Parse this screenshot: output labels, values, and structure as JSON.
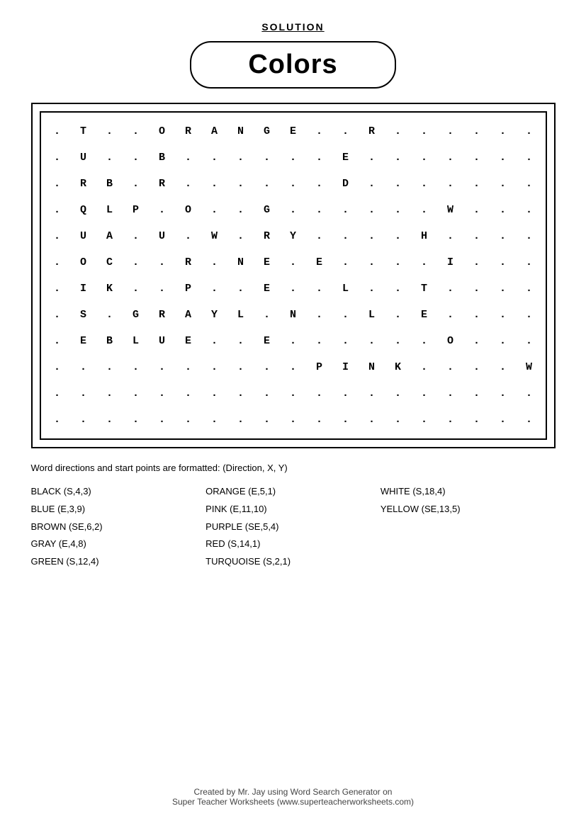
{
  "header": {
    "solution_label": "SOLUTION",
    "title": "Colors"
  },
  "grid": {
    "rows": [
      [
        ".",
        "T",
        ".",
        ".",
        "O",
        "R",
        "A",
        "N",
        "G",
        "E",
        ".",
        ".",
        "R",
        ".",
        ".",
        ".",
        ".",
        ".",
        "."
      ],
      [
        ".",
        "U",
        ".",
        ".",
        "B",
        ".",
        ".",
        ".",
        ".",
        ".",
        ".",
        "E",
        ".",
        ".",
        ".",
        ".",
        ".",
        ".",
        "."
      ],
      [
        ".",
        "R",
        "B",
        ".",
        "R",
        ".",
        ".",
        ".",
        ".",
        ".",
        ".",
        "D",
        ".",
        ".",
        ".",
        ".",
        ".",
        ".",
        "."
      ],
      [
        ".",
        "Q",
        "L",
        "P",
        ".",
        "O",
        ".",
        ".",
        "G",
        ".",
        ".",
        ".",
        ".",
        ".",
        ".",
        "W",
        ".",
        ".",
        "."
      ],
      [
        ".",
        "U",
        "A",
        ".",
        "U",
        ".",
        "W",
        ".",
        "R",
        "Y",
        ".",
        ".",
        ".",
        ".",
        "H",
        ".",
        ".",
        ".",
        "."
      ],
      [
        ".",
        "O",
        "C",
        ".",
        ".",
        "R",
        ".",
        "N",
        "E",
        ".",
        "E",
        ".",
        ".",
        ".",
        ".",
        "I",
        ".",
        ".",
        "."
      ],
      [
        ".",
        "I",
        "K",
        ".",
        ".",
        "P",
        ".",
        ".",
        "E",
        ".",
        ".",
        "L",
        ".",
        ".",
        "T",
        ".",
        ".",
        ".",
        "."
      ],
      [
        ".",
        "S",
        ".",
        "G",
        "R",
        "A",
        "Y",
        "L",
        ".",
        "N",
        ".",
        ".",
        "L",
        ".",
        "E",
        ".",
        ".",
        ".",
        "."
      ],
      [
        ".",
        "E",
        "B",
        "L",
        "U",
        "E",
        ".",
        ".",
        "E",
        ".",
        ".",
        ".",
        ".",
        ".",
        ".",
        "O",
        ".",
        ".",
        "."
      ],
      [
        ".",
        ".",
        ".",
        ".",
        ".",
        ".",
        ".",
        ".",
        ".",
        ".",
        "P",
        "I",
        "N",
        "K",
        ".",
        ".",
        ".",
        ".",
        "W"
      ],
      [
        ".",
        ".",
        ".",
        ".",
        ".",
        ".",
        ".",
        ".",
        ".",
        ".",
        ".",
        ".",
        ".",
        ".",
        ".",
        ".",
        ".",
        ".",
        "."
      ],
      [
        ".",
        ".",
        ".",
        ".",
        ".",
        ".",
        ".",
        ".",
        ".",
        ".",
        ".",
        ".",
        ".",
        ".",
        ".",
        ".",
        ".",
        ".",
        "."
      ]
    ]
  },
  "directions_text": "Word directions and start points are formatted: (Direction, X, Y)",
  "word_list": {
    "column1": [
      "BLACK (S,4,3)",
      "BLUE (E,3,9)",
      "BROWN (SE,6,2)",
      "GRAY (E,4,8)",
      "GREEN (S,12,4)"
    ],
    "column2": [
      "ORANGE (E,5,1)",
      "PINK (E,11,10)",
      "PURPLE (SE,5,4)",
      "RED (S,14,1)",
      "TURQUOISE (S,2,1)"
    ],
    "column3": [
      "WHITE (S,18,4)",
      "YELLOW (SE,13,5)"
    ]
  },
  "footer": {
    "line1": "Created by Mr. Jay using Word Search Generator on",
    "line2": "Super Teacher Worksheets (www.superteacherworksheets.com)"
  }
}
